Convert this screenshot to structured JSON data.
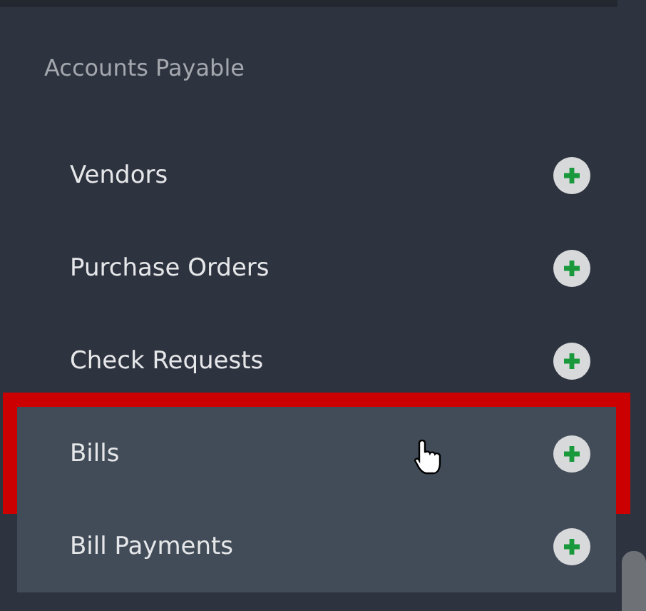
{
  "section": {
    "title": "Accounts Payable"
  },
  "items": [
    {
      "label": "Vendors",
      "highlighted": false,
      "hovered": false,
      "outlined": false
    },
    {
      "label": "Purchase Orders",
      "highlighted": false,
      "hovered": false,
      "outlined": false
    },
    {
      "label": "Check Requests",
      "highlighted": false,
      "hovered": false,
      "outlined": false
    },
    {
      "label": "Bills",
      "highlighted": true,
      "hovered": true,
      "outlined": true
    },
    {
      "label": "Bill Payments",
      "highlighted": true,
      "hovered": false,
      "outlined": false
    }
  ]
}
